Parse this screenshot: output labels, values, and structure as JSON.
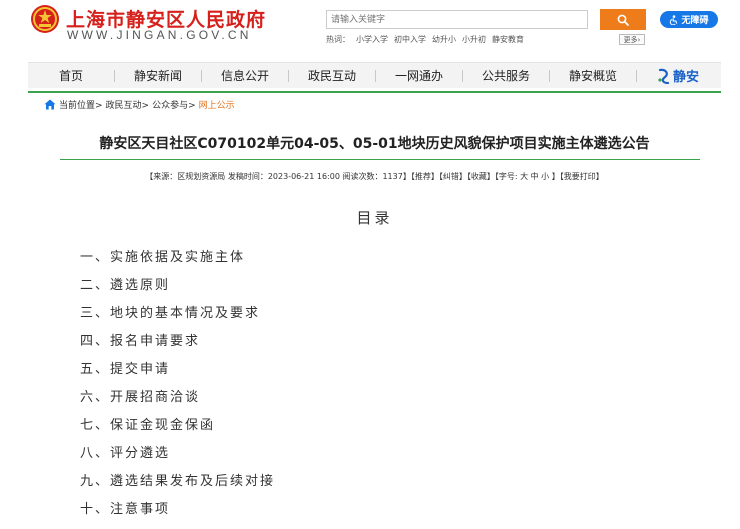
{
  "header": {
    "site_title": "上海市静安区人民政府",
    "site_url": "WWW.JINGAN.GOV.CN",
    "search_placeholder": "请输入关键字",
    "accessibility_label": "无障碍",
    "hot_label": "热词：",
    "hot_words": [
      "小学入学",
      "初中入学",
      "幼升小",
      "小升初",
      "静安教育"
    ],
    "more_label": "更多›"
  },
  "nav": {
    "items": [
      "首页",
      "静安新闻",
      "信息公开",
      "政民互动",
      "一网通办",
      "公共服务",
      "静安概览"
    ],
    "brand_label": "静安"
  },
  "breadcrumb": {
    "prefix": "当前位置>",
    "items": [
      "政民互动>",
      "公众参与>"
    ],
    "current": "网上公示"
  },
  "article": {
    "title": "静安区天目社区C070102单元04-05、05-01地块历史风貌保护项目实施主体遴选公告",
    "meta": "【来源：区规划资源局  发稿时间：2023-06-21 16:00  阅读次数：1137】【推荐】【纠错】【收藏】【字号: 大 中 小 】【我要打印】"
  },
  "toc": {
    "title": "目录",
    "items": [
      "一、实施依据及实施主体",
      "二、遴选原则",
      "三、地块的基本情况及要求",
      "四、报名申请要求",
      "五、提交申请",
      "六、开展招商洽谈",
      "七、保证金现金保函",
      "八、评分遴选",
      "九、遴选结果发布及后续对接",
      "十、注意事项"
    ]
  },
  "colors": {
    "brand_red": "#d6201b",
    "accent_green": "#3aa34b",
    "search_orange": "#ee7c1b",
    "accessibility_blue": "#1677e6",
    "breadcrumb_current": "#e2711d"
  },
  "icons": [
    "national-emblem-icon",
    "search-icon",
    "accessibility-icon",
    "home-icon",
    "jingan-logo-icon"
  ]
}
